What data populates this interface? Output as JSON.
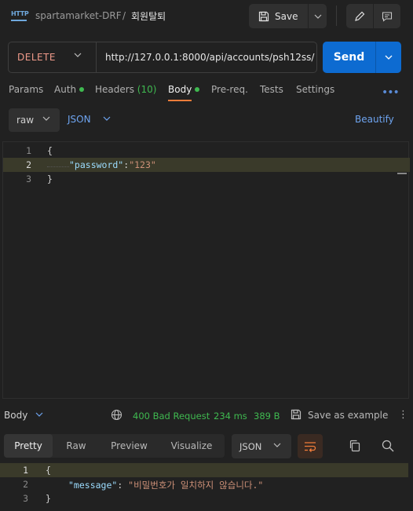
{
  "header": {
    "badge": "HTTP",
    "collection": "spartamarket-DRF",
    "separator": "/",
    "request_name": "회원탈퇴",
    "save_label": "Save"
  },
  "request": {
    "method": "DELETE",
    "url": "http://127.0.0.1:8000/api/accounts/psh12ss/",
    "send_label": "Send"
  },
  "tabs": {
    "params": "Params",
    "auth": "Auth",
    "headers": "Headers",
    "headers_count": "(10)",
    "body": "Body",
    "prereq": "Pre-req.",
    "tests": "Tests",
    "settings": "Settings",
    "more": "•••"
  },
  "body_toolbar": {
    "mode": "raw",
    "language": "JSON",
    "beautify": "Beautify"
  },
  "request_body": {
    "line_numbers": [
      "1",
      "2",
      "3"
    ],
    "line1": "{",
    "key": "\"password\"",
    "colon": ":",
    "value": "\"123\"",
    "line3": "}"
  },
  "response_bar": {
    "label": "Body",
    "status": "400 Bad Request",
    "time": "234 ms",
    "size": "389 B",
    "save_example": "Save as example",
    "more": "⋮"
  },
  "response_toolbar": {
    "pretty": "Pretty",
    "raw": "Raw",
    "preview": "Preview",
    "visualize": "Visualize",
    "format": "JSON"
  },
  "response_body": {
    "line_numbers": [
      "1",
      "2",
      "3"
    ],
    "line1": "{",
    "key": "\"message\"",
    "colon": ": ",
    "value": "\"비밀번호가 일치하지 않습니다.\"",
    "line3": "}"
  },
  "colors": {
    "accent": "#0d6bd1",
    "method_delete": "#f09a8a",
    "status_error_text": "#3fb950",
    "link": "#6ea4f0",
    "active_tab_underline": "#f07c3a"
  },
  "icons": [
    "http-icon",
    "save-icon",
    "chevron-down-icon",
    "pencil-icon",
    "comment-icon",
    "globe-icon",
    "save-example-icon",
    "kebab-icon",
    "wrap-lines-icon",
    "copy-icon",
    "search-icon"
  ]
}
